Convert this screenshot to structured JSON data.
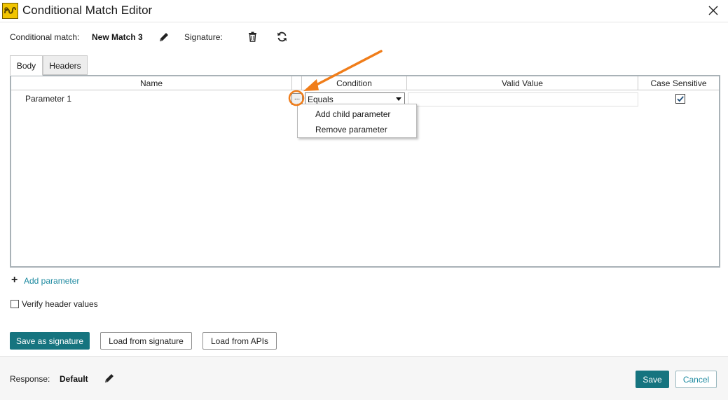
{
  "window": {
    "title": "Conditional Match Editor",
    "app_icon": "app-logo-icon",
    "close_icon": "close-icon"
  },
  "match": {
    "label": "Conditional match:",
    "name": "New Match 3",
    "edit_icon": "pencil-icon",
    "signature_label": "Signature:",
    "delete_icon": "trash-icon",
    "refresh_icon": "refresh-icon"
  },
  "tabs": [
    {
      "label": "Body",
      "active": true
    },
    {
      "label": "Headers",
      "active": false
    }
  ],
  "grid": {
    "columns": [
      "Name",
      "",
      "Condition",
      "Valid Value",
      "Case Sensitive"
    ],
    "rows": [
      {
        "name": "Parameter 1",
        "action": "...",
        "condition": "Equals",
        "valid_value": "",
        "case_sensitive": true
      }
    ]
  },
  "context_menu": {
    "items": [
      "Add child parameter",
      "Remove parameter"
    ]
  },
  "add_parameter": {
    "icon": "plus-icon",
    "label": "Add parameter"
  },
  "verify_header": {
    "label": "Verify header values",
    "checked": false
  },
  "actions": {
    "save_as_signature": "Save as signature",
    "load_from_signature": "Load from signature",
    "load_from_apis": "Load from APIs"
  },
  "footer": {
    "response_label": "Response:",
    "response_value": "Default",
    "edit_icon": "pencil-icon",
    "save": "Save",
    "cancel": "Cancel"
  },
  "colors": {
    "primary": "#16747f",
    "link": "#1e8aa0",
    "annotation": "#f07d1a"
  }
}
